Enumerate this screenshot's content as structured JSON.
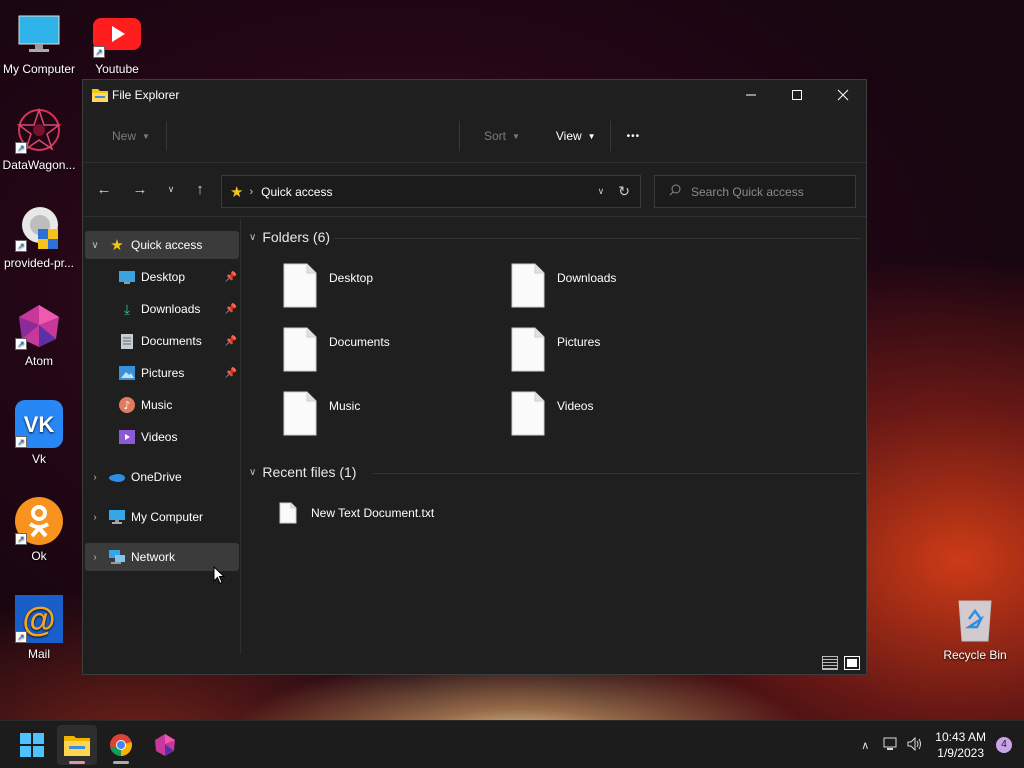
{
  "desktop": {
    "icons": [
      {
        "label": "My Computer",
        "icon": "monitor-icon"
      },
      {
        "label": "Youtube",
        "icon": "youtube-icon"
      },
      {
        "label": "DataWagon...",
        "icon": "datawagon-icon"
      },
      {
        "label": "provided-pr...",
        "icon": "provided-program-icon"
      },
      {
        "label": "Atom",
        "icon": "atom-icon"
      },
      {
        "label": "Vk",
        "icon": "vk-icon"
      },
      {
        "label": "Ok",
        "icon": "ok-icon"
      },
      {
        "label": "Mail",
        "icon": "mail-icon"
      },
      {
        "label": "Recycle Bin",
        "icon": "recycle-bin-icon"
      }
    ]
  },
  "window": {
    "title": "File Explorer",
    "toolbar": {
      "new_label": "New",
      "sort_label": "Sort",
      "view_label": "View",
      "more_label": "•••"
    },
    "address": {
      "path": "Quick access"
    },
    "search": {
      "placeholder": "Search Quick access"
    },
    "sidebar": {
      "items": [
        {
          "label": "Quick access",
          "icon": "star-icon"
        },
        {
          "label": "Desktop",
          "icon": "desktop-icon"
        },
        {
          "label": "Downloads",
          "icon": "download-icon"
        },
        {
          "label": "Documents",
          "icon": "documents-icon"
        },
        {
          "label": "Pictures",
          "icon": "pictures-icon"
        },
        {
          "label": "Music",
          "icon": "music-icon"
        },
        {
          "label": "Videos",
          "icon": "videos-icon"
        },
        {
          "label": "OneDrive",
          "icon": "cloud-icon"
        },
        {
          "label": "My Computer",
          "icon": "computer-icon"
        },
        {
          "label": "Network",
          "icon": "network-icon"
        }
      ]
    },
    "content": {
      "folders_header": "Folders (6)",
      "folders": [
        "Desktop",
        "Downloads",
        "Documents",
        "Pictures",
        "Music",
        "Videos"
      ],
      "recent_header": "Recent files (1)",
      "recent": [
        "New Text Document.txt"
      ]
    }
  },
  "taskbar": {
    "apps": [
      {
        "name": "start",
        "icon": "windows-start-icon"
      },
      {
        "name": "file-explorer",
        "icon": "folder-icon"
      },
      {
        "name": "chrome",
        "icon": "chrome-icon"
      },
      {
        "name": "atom",
        "icon": "atom-icon"
      }
    ],
    "time": "10:43 AM",
    "date": "1/9/2023",
    "notifications": "4"
  },
  "colors": {
    "accent_yellow": "#f5c518",
    "desktop_bg": "#240716",
    "window_bg": "#1f1f1f"
  }
}
